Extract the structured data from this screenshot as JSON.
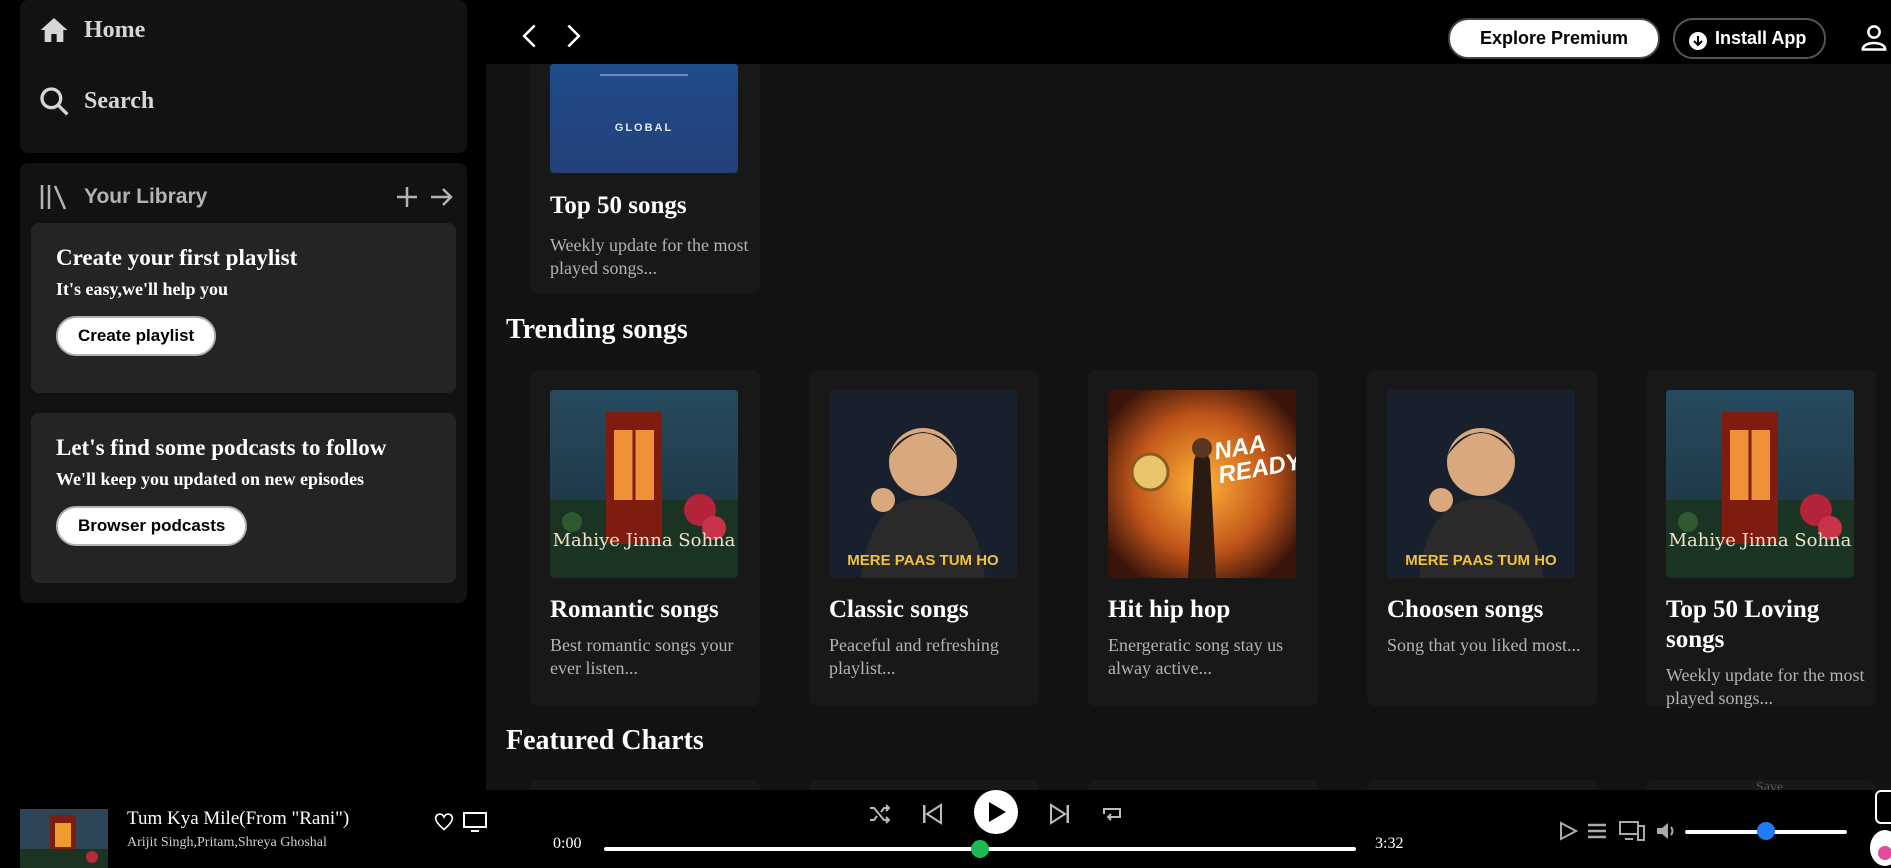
{
  "sidebar": {
    "home_label": "Home",
    "search_label": "Search",
    "library_label": "Your Library",
    "playlist_card": {
      "title": "Create your first playlist",
      "subtitle": "It's easy,we'll help you",
      "button": "Create playlist"
    },
    "podcast_card": {
      "title": "Let's find some podcasts to follow",
      "subtitle": "We'll keep you updated on new episodes",
      "button": "Browser podcasts"
    }
  },
  "topbar": {
    "explore_label": "Explore Premium",
    "install_label": "Install App"
  },
  "top_section": {
    "cover_text": "GLOBAL",
    "title": "Top 50 songs",
    "description": "Weekly update for the most played songs..."
  },
  "trending": {
    "heading": "Trending songs",
    "items": [
      {
        "title": "Romantic songs",
        "description": "Best romantic songs your ever listen...",
        "cover_text": "Mahiye Jinna Sohna",
        "cover": "mahiye"
      },
      {
        "title": "Classic songs",
        "description": "Peaceful and refreshing playlist...",
        "cover_text": "MERE PAAS TUM HO",
        "cover": "merepaas"
      },
      {
        "title": "Hit hip hop",
        "description": "Energeratic song stay us alway active...",
        "cover_text": "NAA READY",
        "cover": "leo"
      },
      {
        "title": "Choosen songs",
        "description": "Song that you liked most...",
        "cover_text": "MERE PAAS TUM HO",
        "cover": "merepaas"
      },
      {
        "title": "Top 50 Loving songs",
        "description": "Weekly update for the most played songs...",
        "cover_text": "Mahiye Jinna Sohna",
        "cover": "mahiye"
      }
    ]
  },
  "featured": {
    "heading": "Featured Charts",
    "partial_text": "Save"
  },
  "player": {
    "title": "Tum Kya Mile(From \"Rani\")",
    "artist": "Arijit Singh,Pritam,Shreya Ghoshal",
    "current_time": "0:00",
    "total_time": "3:32",
    "progress": 0.5,
    "volume": 0.5
  },
  "colors": {
    "accent_green": "#1db954",
    "volume_blue": "#1e7cf5",
    "panel": "#121212",
    "card": "#242424"
  }
}
